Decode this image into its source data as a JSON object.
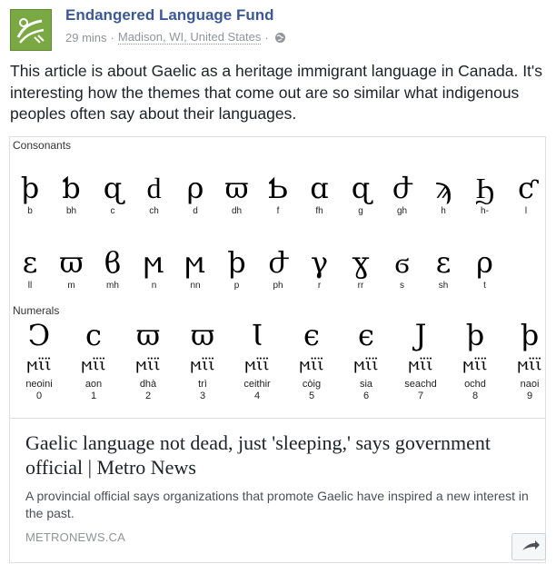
{
  "header": {
    "page_name": "Endangered Language Fund",
    "time": "29 mins",
    "separator": "·",
    "location": "Madison, WI, United States",
    "separator2": "·",
    "privacy_icon": "globe-icon",
    "avatar_icon": "language-fund-logo-icon",
    "avatar_color": "#7aa843",
    "link_color": "#3b5998"
  },
  "post": {
    "text": "This article is about Gaelic as a heritage immigrant language in Canada. It's interesting how the themes that come out are so similar what indigenous peoples often say about their languages."
  },
  "card": {
    "image": {
      "consonants_label": "Consonants",
      "numerals_label": "Numerals",
      "consonant_row1": [
        "b",
        "bh",
        "c",
        "ch",
        "d",
        "dh",
        "f",
        "fh",
        "g",
        "gh",
        "h",
        "h-",
        "l"
      ],
      "consonant_row2": [
        "ll",
        "m",
        "mh",
        "n",
        "nn",
        "p",
        "ph",
        "r",
        "rr",
        "s",
        "sh",
        "t"
      ],
      "numerals": [
        {
          "word": "neoini",
          "digit": "0"
        },
        {
          "word": "aon",
          "digit": "1"
        },
        {
          "word": "dhà",
          "digit": "2"
        },
        {
          "word": "trì",
          "digit": "3"
        },
        {
          "word": "ceithir",
          "digit": "4"
        },
        {
          "word": "còig",
          "digit": "5"
        },
        {
          "word": "sia",
          "digit": "6"
        },
        {
          "word": "seachd",
          "digit": "7"
        },
        {
          "word": "ochd",
          "digit": "8"
        },
        {
          "word": "naoi",
          "digit": "9"
        }
      ]
    },
    "title": "Gaelic language not dead, just 'sleeping,' says government official | Metro News",
    "description": "A provincial official says organizations that promote Gaelic have inspired a new interest in the past.",
    "domain": "METRONEWS.CA",
    "share_icon": "share-icon"
  }
}
